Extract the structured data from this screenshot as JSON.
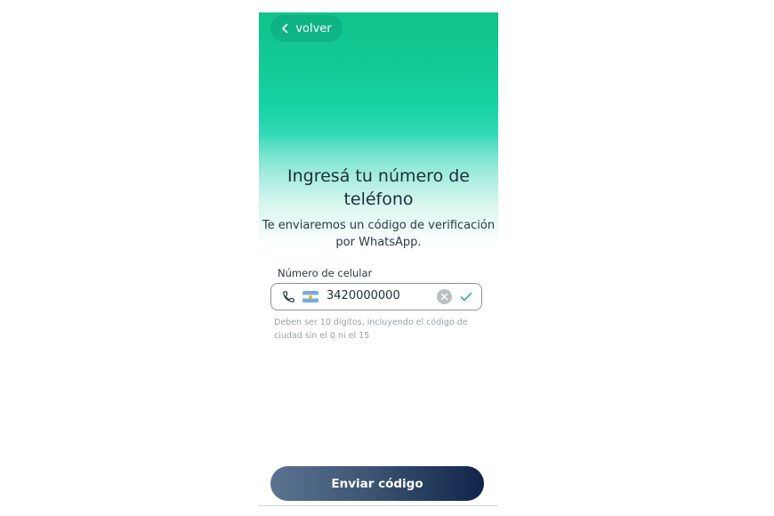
{
  "header": {
    "back_label": "volver"
  },
  "main": {
    "title": "Ingresá tu número de teléfono",
    "subtitle": "Te enviaremos un código de verificación por WhatsApp."
  },
  "form": {
    "label": "Número de celular",
    "phone_value": "3420000000",
    "country_flag": "argentina-flag",
    "helper": "Deben ser 10 digitos, incluyendo el código de ciudad sin el 0 ni el 15"
  },
  "footer": {
    "submit_label": "Enviar código"
  },
  "colors": {
    "header_gradient_top": "#0fc48a",
    "button_dark": "#10254a",
    "check_green": "#26b57c"
  }
}
